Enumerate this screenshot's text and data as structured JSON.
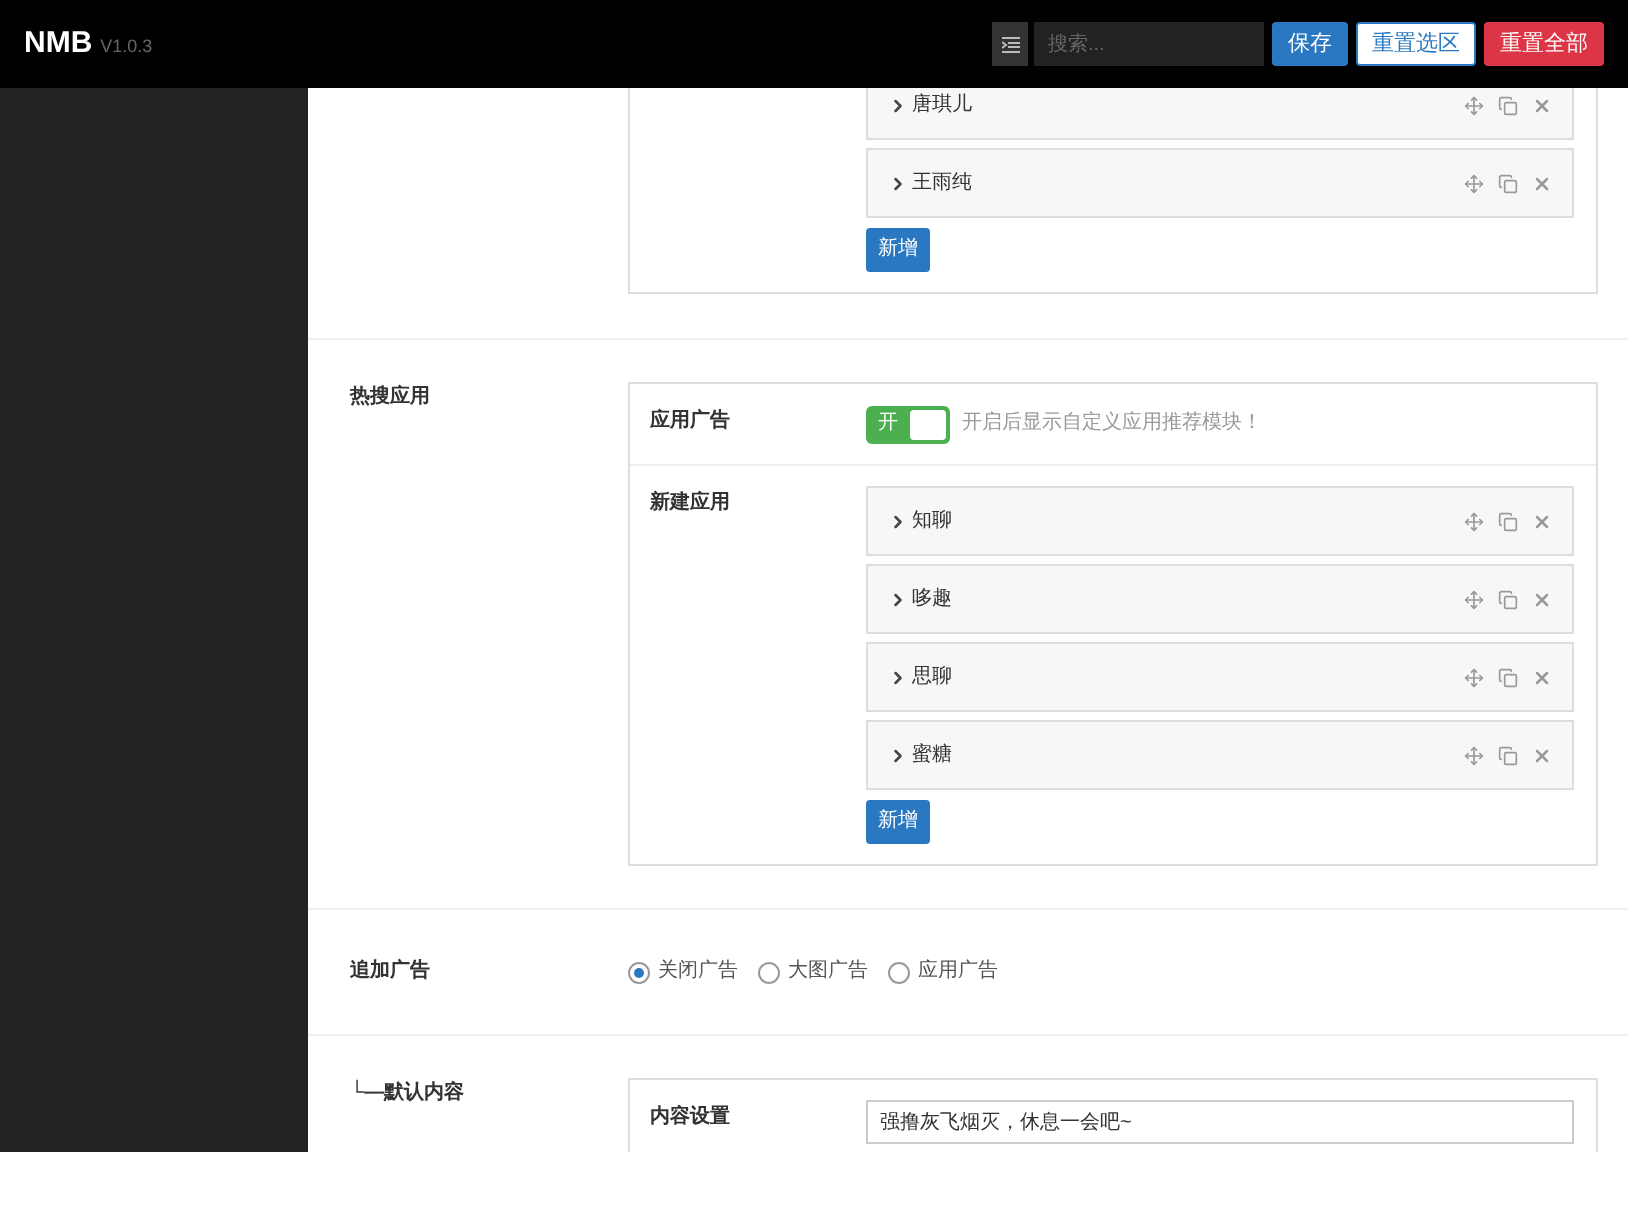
{
  "header": {
    "logo": "NMB",
    "version": "V1.0.3",
    "search": {
      "placeholder": "搜索..."
    },
    "buttons": [
      {
        "label": "保存",
        "kind": "primary"
      },
      {
        "label": "重置选区",
        "kind": "outline"
      },
      {
        "label": "重置全部",
        "kind": "danger"
      }
    ]
  },
  "sections": [
    {
      "kind": "panel",
      "rows": [
        {
          "kind": "list",
          "items": [
            {
              "label": "唐琪儿"
            },
            {
              "label": "王雨纯"
            }
          ],
          "add_button": "新增"
        }
      ]
    },
    {
      "kind": "panel",
      "label": "热搜应用",
      "rows": [
        {
          "kind": "toggle",
          "label": "应用广告",
          "on": true,
          "toggle_text": "开",
          "hint": "开启后显示自定义应用推荐模块！"
        },
        {
          "kind": "list",
          "label": "新建应用",
          "items": [
            {
              "label": "知聊"
            },
            {
              "label": "哆趣"
            },
            {
              "label": "思聊"
            },
            {
              "label": "蜜糖"
            }
          ],
          "add_button": "新增"
        }
      ]
    },
    {
      "kind": "radio",
      "label": "追加广告",
      "options": [
        {
          "label": "关闭广告",
          "selected": true
        },
        {
          "label": "大图广告",
          "selected": false
        },
        {
          "label": "应用广告",
          "selected": false
        }
      ]
    },
    {
      "kind": "panel",
      "label": "└—默认内容",
      "rows": [
        {
          "kind": "text",
          "label": "内容设置",
          "value": "强撸灰飞烟灭，休息一会吧~"
        }
      ]
    }
  ]
}
